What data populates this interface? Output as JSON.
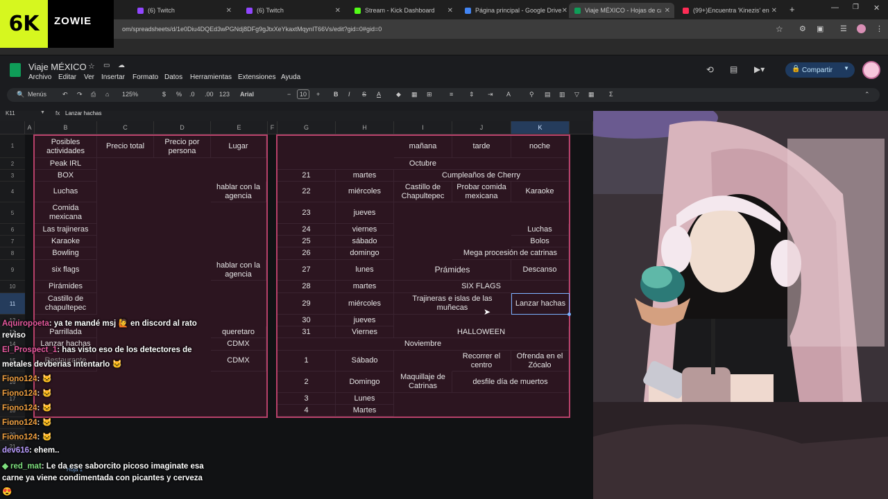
{
  "browser": {
    "tabs": [
      {
        "label": "(6) Twitch",
        "icon_color": "#9146ff"
      },
      {
        "label": "(6) Twitch",
        "icon_color": "#9146ff"
      },
      {
        "label": "Stream - Kick Dashboard",
        "icon_color": "#53fc18"
      },
      {
        "label": "Página principal - Google Drive",
        "icon_color": "#4285f4"
      },
      {
        "label": "Viaje MÉXICO - Hojas de cálcul",
        "icon_color": "#0f9d58"
      },
      {
        "label": "(99+)Encuentra 'Kinezis' en Tik",
        "icon_color": "#fe2c55"
      }
    ],
    "url": "om/spreadsheets/d/1e0Diu4DQEd3wPGNdj8DFg9gJtxXeYkaxtMqynIT66Vs/edit?gid=0#gid=0"
  },
  "overlay": {
    "logo_text": "6K",
    "brand": "ZOWIE"
  },
  "sheets": {
    "title": "Viaje MÉXICO",
    "menu": [
      "Archivo",
      "Editar",
      "Ver",
      "Insertar",
      "Formato",
      "Datos",
      "Herramientas",
      "Extensiones",
      "Ayuda"
    ],
    "share_label": "Compartir",
    "toolbar": {
      "search": "Menús",
      "zoom": "125%",
      "currency": "$",
      "percent": "%",
      "dec_less": ".0",
      "dec_more": ".00",
      "number": "123",
      "font": "Arial",
      "font_size": "10"
    },
    "name_box": "K11",
    "formula": "Lanzar hachas",
    "columns": [
      "A",
      "B",
      "C",
      "D",
      "E",
      "F",
      "G",
      "H",
      "I",
      "J",
      "K"
    ],
    "rows": [
      "1",
      "2",
      "3",
      "4",
      "5",
      "6",
      "7",
      "8",
      "9",
      "10",
      "11",
      "12",
      "13",
      "14",
      "15",
      "16",
      "17",
      "18",
      "19",
      "20",
      "21"
    ],
    "left_table": {
      "headers": [
        "Posibles actividades",
        "Precio total",
        "Precio por persona",
        "Lugar"
      ],
      "rows": [
        [
          "Peak IRL",
          "",
          "",
          ""
        ],
        [
          "BOX",
          "",
          "",
          ""
        ],
        [
          "Luchas",
          "",
          "",
          "hablar con la agencia"
        ],
        [
          "Comida mexicana",
          "",
          "",
          ""
        ],
        [
          "Las trajineras",
          "",
          "",
          ""
        ],
        [
          "Karaoke",
          "",
          "",
          ""
        ],
        [
          "Bowling",
          "",
          "",
          ""
        ],
        [
          "six flags",
          "",
          "",
          "hablar con la agencia"
        ],
        [
          "Pirámides",
          "",
          "",
          ""
        ],
        [
          "Castillo de chapultepec",
          "",
          "",
          ""
        ],
        [
          "",
          "",
          "",
          ""
        ],
        [
          "Parrillada",
          "",
          "",
          "queretaro"
        ],
        [
          "Lanzar hachas",
          "",
          "",
          "CDMX"
        ],
        [
          "Restaurante",
          "",
          "",
          "CDMX"
        ]
      ]
    },
    "right_table": {
      "headers": [
        "mañana",
        "tarde",
        "noche"
      ],
      "month1": "Octubre",
      "month2": "Noviembre",
      "days": [
        {
          "d": "21",
          "w": "martes",
          "span": "Cumpleaños de Cherry"
        },
        {
          "d": "22",
          "w": "miércoles",
          "i": "Castillo de Chapultepec",
          "j": "Probar comida mexicana",
          "k": "Karaoke"
        },
        {
          "d": "23",
          "w": "jueves"
        },
        {
          "d": "24",
          "w": "viernes",
          "k": "Luchas"
        },
        {
          "d": "25",
          "w": "sábado",
          "k": "Bolos"
        },
        {
          "d": "26",
          "w": "domingo",
          "jk": "Mega procesión de catrinas"
        },
        {
          "d": "27",
          "w": "lunes",
          "ij": "Prámides",
          "k": "Descanso"
        },
        {
          "d": "28",
          "w": "martes",
          "span": "SIX FLAGS"
        },
        {
          "d": "29",
          "w": "miércoles",
          "ij": "Trajineras e islas de las muñecas",
          "k": "Lanzar hachas"
        },
        {
          "d": "30",
          "w": "jueves"
        },
        {
          "d": "31",
          "w": "Viernes",
          "span": "HALLOWEEN"
        },
        {
          "d": "1",
          "w": "Sábado",
          "j": "Recorrer el centro",
          "k": "Ofrenda en el Zócalo"
        },
        {
          "d": "2",
          "w": "Domingo",
          "i": "Maquillaje de Catrinas",
          "jk": "desfile día de muertos"
        },
        {
          "d": "3",
          "w": "Lunes"
        },
        {
          "d": "4",
          "w": "Martes"
        }
      ]
    },
    "sheet_tab": "Hoja 1"
  },
  "chat": [
    {
      "user": "Aquiropoeta",
      "color": "#e85aa0",
      "text": ": ya te mandé msj 🙋 en discord al rato"
    },
    {
      "user": "",
      "color": "#ffffff",
      "text": "reviso"
    },
    {
      "user": "El_Prospect_1",
      "color": "#e85aa0",
      "text": ": has visto eso de los detectores de"
    },
    {
      "user": "",
      "color": "#ffffff",
      "text": "metales devberias intentarlo 🐱"
    },
    {
      "user": "Fiono124",
      "color": "#f0a040",
      "text": ": 🐱"
    },
    {
      "user": "Fiono124",
      "color": "#f0a040",
      "text": ": 🐱"
    },
    {
      "user": "Fiono124",
      "color": "#f0a040",
      "text": ": 🐱"
    },
    {
      "user": "Fiono124",
      "color": "#f0a040",
      "text": ": 🐱"
    },
    {
      "user": "Fiono124",
      "color": "#f0a040",
      "text": ": 🐱"
    },
    {
      "user": "dev616",
      "color": "#b99cff",
      "text": ": ehem.."
    },
    {
      "user": "◆ red_mat",
      "color": "#7ee07e",
      "text": ": Le da ese saborcito picoso imaginate esa"
    },
    {
      "user": "",
      "color": "#ffffff",
      "text": "carne ya viene condimentada con picantes y cerveza"
    },
    {
      "user": "",
      "color": "#ffffff",
      "text": "😍"
    }
  ]
}
